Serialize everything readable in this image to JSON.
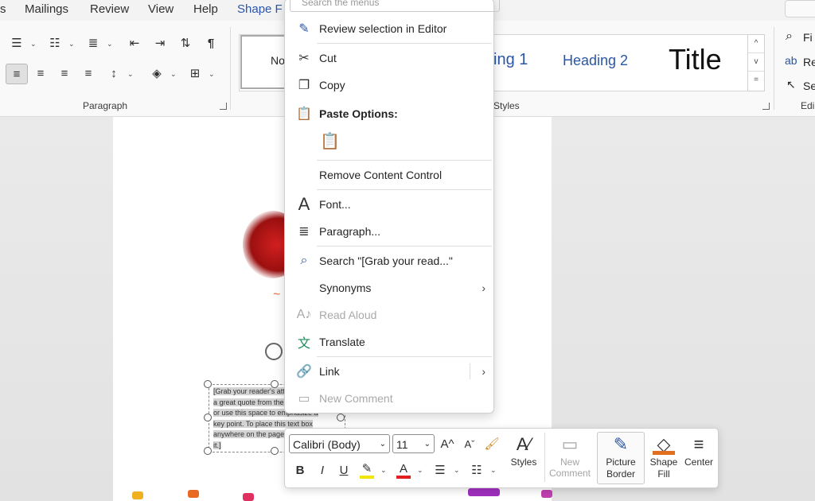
{
  "tabs": [
    "s",
    "Mailings",
    "Review",
    "View",
    "Help",
    "Shape F"
  ],
  "ribbon": {
    "paragraph_label": "Paragraph",
    "styles_label": "Styles",
    "editing_label": "Edi",
    "styles": {
      "normal": "No",
      "heading1": "ing 1",
      "heading2": "Heading 2",
      "title": "Title"
    },
    "editing": {
      "find": "Fi",
      "replace": "Re",
      "select": "Se"
    },
    "scroll": [
      "^",
      "v",
      "="
    ]
  },
  "context_menu": {
    "search_placeholder": "Search the menus",
    "items": [
      {
        "label": "Review selection in Editor"
      },
      {
        "label": "Cut"
      },
      {
        "label": "Copy"
      },
      {
        "label": "Paste Options:"
      },
      {
        "label": "Remove Content Control"
      },
      {
        "label": "Font..."
      },
      {
        "label": "Paragraph..."
      },
      {
        "label": "Search \"[Grab your read...\""
      },
      {
        "label": "Synonyms"
      },
      {
        "label": "Read Aloud"
      },
      {
        "label": "Translate"
      },
      {
        "label": "Link"
      },
      {
        "label": "New Comment"
      }
    ]
  },
  "textbox": {
    "text": "[Grab your reader's attention with a great quote from the document or use this space to emphasize a key point. To place this text box anywhere on the page, just drag it.]"
  },
  "mini_toolbar": {
    "font": "Calibri (Body)",
    "size": "11",
    "bold": "B",
    "italic": "I",
    "underline": "U",
    "styles": "Styles",
    "new_comment_line1": "New",
    "new_comment_line2": "Comment",
    "picture_border_line1": "Picture",
    "picture_border_line2": "Border",
    "shape_fill_line1": "Shape",
    "shape_fill_line2": "Fill",
    "center": "Center"
  },
  "colors": {
    "accent": "#2b56a8",
    "highlight": "#f2e500",
    "font_color": "#e02020",
    "shape_fill": "#e07020"
  }
}
